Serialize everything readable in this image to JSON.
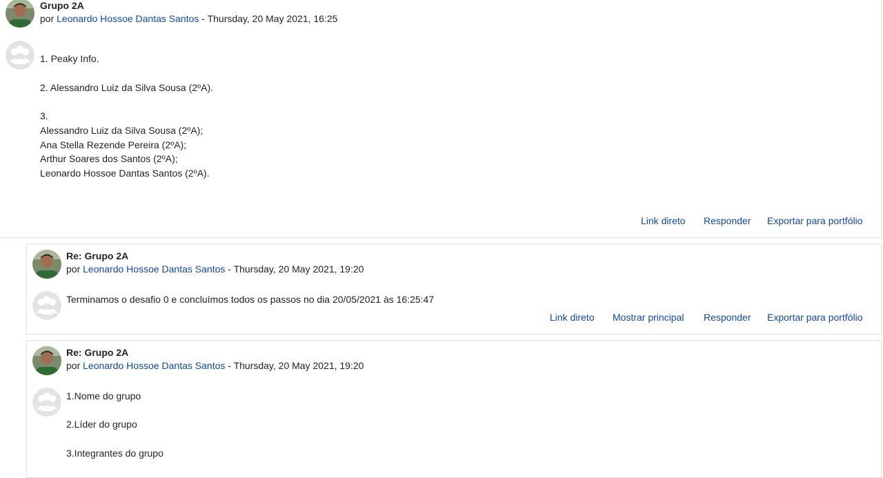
{
  "by_word": "por",
  "separator": " - ",
  "posts": [
    {
      "subject": "Grupo 2A",
      "author": "Leonardo Hossoe Dantas Santos",
      "date": "Thursday, 20 May 2021, 16:25",
      "lines": [
        "1. Peaky Info.",
        "2. Alessandro Luiz da Silva Sousa (2ºA).",
        "3.",
        "Alessandro Luiz da Silva Sousa (2ºA);",
        "Ana Stella Rezende Pereira (2ºA);",
        "Arthur Soares dos Santos (2ºA);",
        "Leonardo Hossoe Dantas Santos (2ºA)."
      ],
      "commands": [
        "Link direto",
        "Responder",
        "Exportar para portfólio"
      ]
    },
    {
      "subject": "Re: Grupo 2A",
      "author": "Leonardo Hossoe Dantas Santos",
      "date": "Thursday, 20 May 2021, 19:20",
      "lines": [
        "Terminamos o desafio 0 e concluímos todos os passos no dia 20/05/2021 às 16:25:47"
      ],
      "commands": [
        "Link direto",
        "Mostrar principal",
        "Responder",
        "Exportar para portfólio"
      ]
    },
    {
      "subject": "Re: Grupo 2A",
      "author": "Leonardo Hossoe Dantas Santos",
      "date": "Thursday, 20 May 2021, 19:20",
      "lines": [
        "1.Nome do grupo",
        "2.Líder do grupo",
        "3.Integrantes do grupo"
      ]
    }
  ]
}
